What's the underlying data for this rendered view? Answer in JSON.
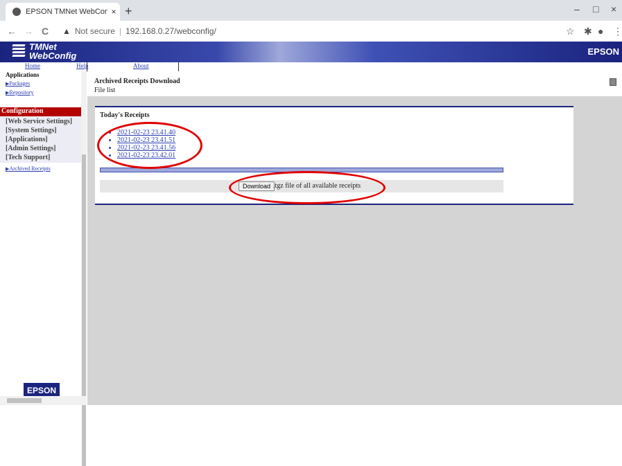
{
  "browser": {
    "tab_title": "EPSON TMNet WebConfig Versio",
    "tab_close": "×",
    "new_tab": "+",
    "min": "–",
    "max": "□",
    "close": "×",
    "back": "←",
    "forward": "→",
    "reload": "C",
    "warning_icon": "▲",
    "not_secure": "Not secure",
    "url": "192.168.0.27/webconfig/"
  },
  "header": {
    "brand_line1": "TMNet",
    "brand_line2": "WebConfig",
    "epson": "EPSON"
  },
  "menu": {
    "home": "Home",
    "help": "Help",
    "about": "About"
  },
  "sidebar": {
    "top_label": "Applications",
    "packages": "Packages",
    "repository": "Repository",
    "configuration": "Configuration",
    "items": [
      "[Web Service Settings]",
      "[System Settings]",
      "[Applications]",
      "[Admin Settings]",
      "[Tech Support]"
    ],
    "archived": "Archived Receipts",
    "epson_logo": "EPSON"
  },
  "main": {
    "title": "Archived Receipts Download",
    "subtitle": "File list",
    "card_title": "Today's Receipts",
    "receipts": [
      "2021-02-23 23.41.40",
      "2021-02-23 23.41.51",
      "2021-02-23 23.41.56",
      "2021-02-23 23.42.01"
    ],
    "download_button": "Download",
    "download_text": ".tgz file of all available receipts"
  },
  "colors": {
    "header_blue": "#1a237e",
    "config_red": "#b30000",
    "link": "#2a3bb0",
    "annotation_red": "#e00000"
  }
}
